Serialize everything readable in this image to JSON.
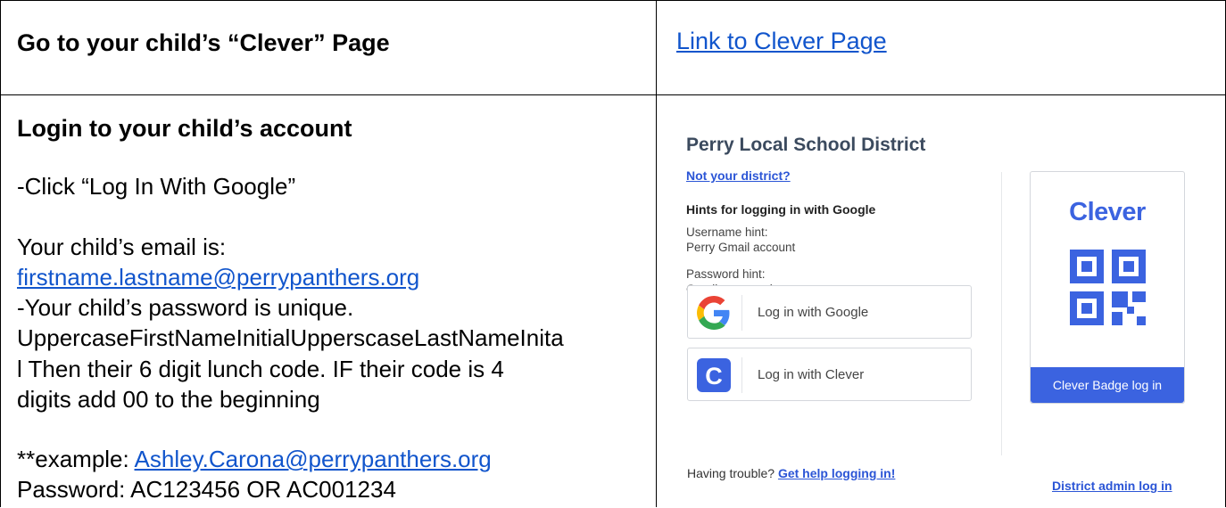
{
  "row1": {
    "heading": "Go to your child’s “Clever” Page",
    "link": "Link to Clever Page"
  },
  "row2": {
    "heading": "Login to your child’s account",
    "step1": "-Click “Log In With Google”",
    "email_intro": "Your child’s email is:",
    "email_link": "firstname.lastname@perrypanthers.org",
    "pw_line1": "-Your child’s password is unique.",
    "pw_line2": "UppercaseFirstNameInitialUpperscaseLastNameInita",
    "pw_line3": "l  Then their 6 digit lunch code. IF their code is 4",
    "pw_line4": "digits add 00 to the beginning",
    "example_prefix": "**example: ",
    "example_link": "Ashley.Carona@perrypanthers.org",
    "example_password": "Password: AC123456 OR AC001234"
  },
  "clever": {
    "district": "Perry Local School District",
    "not_district": "Not your district?",
    "hints_title": "Hints for logging in with Google",
    "username_hint_label": "Username hint:",
    "username_hint_value": "Perry Gmail account",
    "password_hint_label": "Password hint:",
    "password_hint_value": "Gmail password",
    "google_button": "Log in with Google",
    "clever_button": "Log in with Clever",
    "trouble_text": "Having trouble?",
    "trouble_link": "Get help logging in!",
    "badge_logo": "Clever",
    "badge_button": "Clever Badge log in",
    "admin_link": "District admin log in",
    "colors": {
      "brand": "#3b63e0",
      "link": "#2b55d6",
      "doc_link": "#1155cc"
    },
    "icons": [
      "google-icon",
      "clever-c-icon",
      "qr-code-icon"
    ]
  }
}
